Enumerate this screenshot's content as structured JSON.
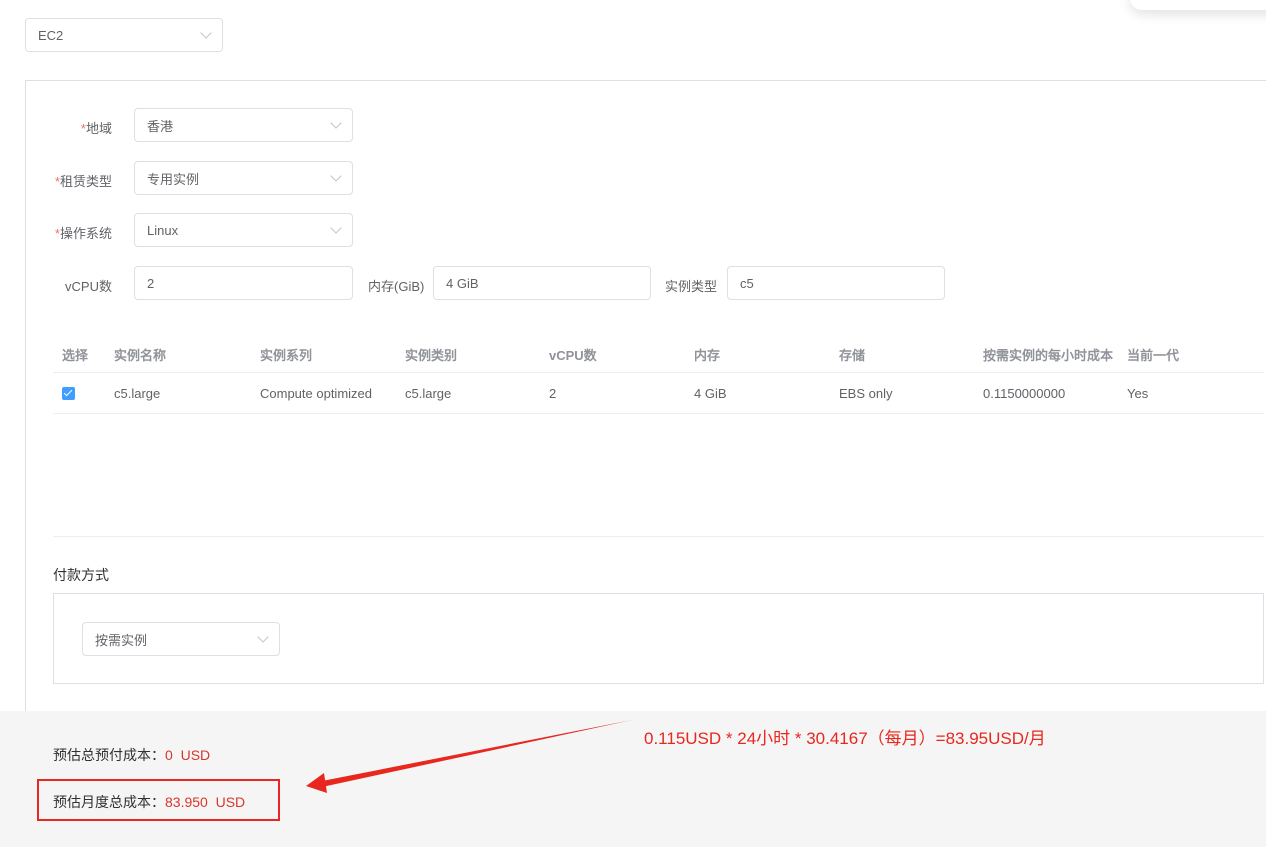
{
  "service": {
    "selected": "EC2"
  },
  "form": {
    "region": {
      "required_mark": "*",
      "label": "地域",
      "value": "香港"
    },
    "tenancy": {
      "required_mark": "*",
      "label": "租赁类型",
      "value": "专用实例"
    },
    "os": {
      "required_mark": "*",
      "label": "操作系统",
      "value": "Linux"
    },
    "vcpu": {
      "label": "vCPU数",
      "value": "2"
    },
    "memory": {
      "label": "内存(GiB)",
      "value": "4 GiB"
    },
    "instance_type": {
      "label": "实例类型",
      "value": "c5"
    }
  },
  "table": {
    "headers": [
      "选择",
      "实例名称",
      "实例系列",
      "实例类别",
      "vCPU数",
      "内存",
      "存储",
      "按需实例的每小时成本",
      "当前一代"
    ],
    "rows": [
      {
        "checked": true,
        "cells": [
          "c5.large",
          "Compute optimized",
          "c5.large",
          "2",
          "4 GiB",
          "EBS only",
          "0.1150000000",
          "Yes"
        ]
      }
    ]
  },
  "payment": {
    "title": "付款方式",
    "value": "按需实例"
  },
  "footer": {
    "upfront": {
      "label": "预估总预付成本：",
      "value": "0",
      "unit": "USD"
    },
    "monthly": {
      "label": "预估月度总成本：",
      "value": "83.950",
      "unit": "USD"
    }
  },
  "annotation": {
    "text": "0.115USD * 24小时 * 30.4167（每月）=83.95USD/月",
    "color": "#e8271f"
  },
  "colors": {
    "accent": "#409eff",
    "required": "#f56c6c",
    "cost": "#d9352b"
  }
}
